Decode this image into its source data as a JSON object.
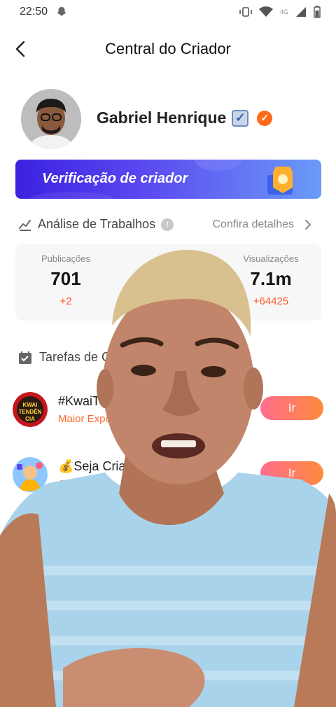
{
  "status_bar": {
    "time": "22:50",
    "network": "4G"
  },
  "header": {
    "title": "Central do Criador"
  },
  "profile": {
    "name": "Gabriel Henrique"
  },
  "banner": {
    "text": "Verificação de criador"
  },
  "analysis": {
    "title": "Análise de Trabalhos",
    "details_label": "Confira detalhes",
    "stats": [
      {
        "label": "Publicações",
        "value": "701",
        "delta": "+2"
      },
      {
        "label": "Visualizações",
        "value": "7.1m",
        "delta": "+64425"
      }
    ]
  },
  "tasks": {
    "title": "Tarefas de C",
    "items": [
      {
        "name": "#KwaiT",
        "subtitle": "Maior Expo",
        "button": "Ir",
        "icon_text": "KWAI TENDÊN CIA"
      },
      {
        "name": "💰Seja Cria",
        "subtitle": "Criador C",
        "button": "Ir"
      }
    ]
  },
  "colors": {
    "accent": "#ff6a1a",
    "banner_start": "#3a22e0",
    "banner_end": "#6a9bf8",
    "button_start": "#ff6d8e",
    "button_end": "#ff8a3a"
  }
}
